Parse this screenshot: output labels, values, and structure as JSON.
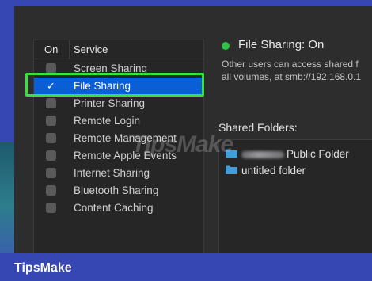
{
  "service_list": {
    "col_on": "On",
    "col_service": "Service",
    "items": [
      {
        "label": "Screen Sharing",
        "checked": false,
        "selected": false
      },
      {
        "label": "File Sharing",
        "checked": true,
        "selected": true
      },
      {
        "label": "Printer Sharing",
        "checked": false,
        "selected": false
      },
      {
        "label": "Remote Login",
        "checked": false,
        "selected": false
      },
      {
        "label": "Remote Management",
        "checked": false,
        "selected": false
      },
      {
        "label": "Remote Apple Events",
        "checked": false,
        "selected": false
      },
      {
        "label": "Internet Sharing",
        "checked": false,
        "selected": false
      },
      {
        "label": "Bluetooth Sharing",
        "checked": false,
        "selected": false
      },
      {
        "label": "Content Caching",
        "checked": false,
        "selected": false
      }
    ],
    "check_glyph": "✓"
  },
  "status": {
    "title": "File Sharing: On",
    "description": "Other users can access shared f\nall volumes, at smb://192.168.0.1",
    "indicator_color": "#2fc247"
  },
  "shared_folders": {
    "label": "Shared Folders:",
    "items": [
      {
        "label": "Public Folder",
        "icon": "folder-icon",
        "name_redacted": true
      },
      {
        "label": "untitled folder",
        "icon": "folder-icon",
        "name_redacted": false
      }
    ]
  },
  "watermark": {
    "text": "TipsMake"
  },
  "brand": {
    "text": "TipsMake"
  },
  "colors": {
    "accent_selected": "#0a5fd6",
    "highlight_outline": "#36e23a",
    "brand_bar": "#3646b2",
    "folder_icon": "#3f9fdc"
  }
}
